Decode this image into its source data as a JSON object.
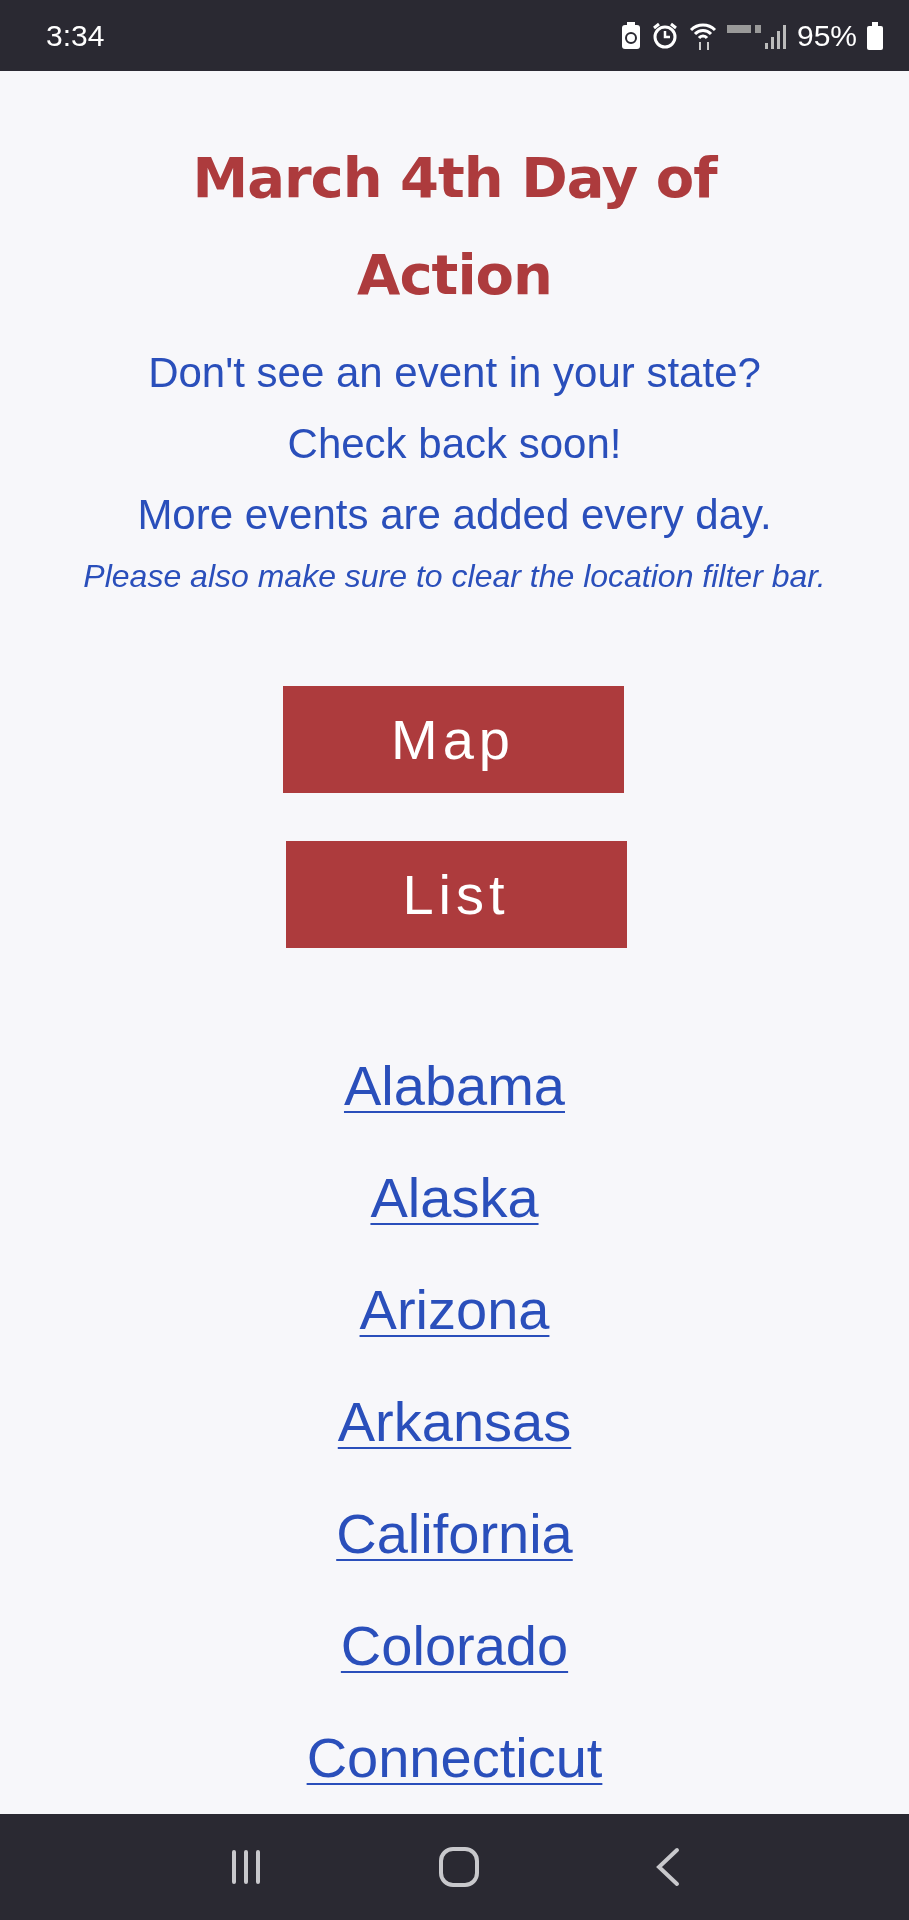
{
  "status_bar": {
    "time": "3:34",
    "battery": "95%"
  },
  "title": "March 4th Day of Action",
  "message_lines": [
    "Don't see an event in your state?",
    "Check back soon!",
    "More events are added every day."
  ],
  "note": "Please also make sure to clear the location filter bar.",
  "buttons": [
    "Map",
    "List"
  ],
  "states": [
    "Alabama",
    "Alaska",
    "Arizona",
    "Arkansas",
    "California",
    "Colorado",
    "Connecticut"
  ]
}
